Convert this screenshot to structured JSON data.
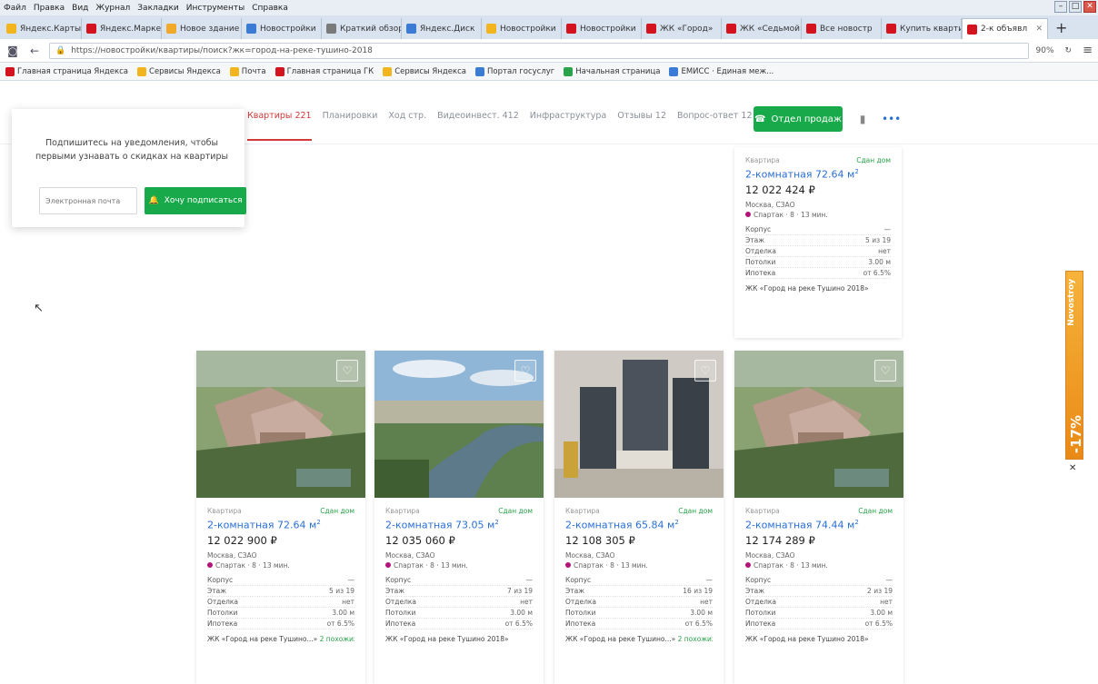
{
  "browser": {
    "menu": [
      "Файл",
      "Правка",
      "Вид",
      "Журнал",
      "Закладки",
      "Инструменты",
      "Справка"
    ],
    "tabs": [
      {
        "label": "Яндекс.Карты",
        "color": "#f2b51e"
      },
      {
        "label": "Яндекс.Маркет",
        "color": "#d3141e"
      },
      {
        "label": "Новое здание",
        "color": "#f1a92a"
      },
      {
        "label": "Новостройки",
        "color": "#3a7bd5"
      },
      {
        "label": "Краткий обзор",
        "color": "#7a7a7a"
      },
      {
        "label": "Яндекс.Диск",
        "color": "#3a7bd5"
      },
      {
        "label": "Новостройки",
        "color": "#f2b51e"
      },
      {
        "label": "Новостройки",
        "color": "#d3141e"
      },
      {
        "label": "ЖК «Город»",
        "color": "#d3141e"
      },
      {
        "label": "ЖК «Седьмой»",
        "color": "#d3141e"
      },
      {
        "label": "Все новостр",
        "color": "#d3141e"
      },
      {
        "label": "Купить квартиру",
        "color": "#d3141e"
      }
    ],
    "active_tab": "2-к объявл",
    "url": "https://новостройки/квартиры/поиск?жк=город-на-реке-тушино-2018",
    "zoom": "90%",
    "bookmarks": [
      {
        "label": "Главная страница Яндекса",
        "color": "#d3141e"
      },
      {
        "label": "Сервисы Яндекса",
        "color": "#f2b51e"
      },
      {
        "label": "Почта",
        "color": "#f2b51e"
      },
      {
        "label": "Главная страница ГК",
        "color": "#d3141e"
      },
      {
        "label": "Сервисы Яндекса",
        "color": "#f2b51e"
      },
      {
        "label": "Портал госуслуг",
        "color": "#3a7bd5"
      },
      {
        "label": "Начальная страница",
        "color": "#2aa34a"
      },
      {
        "label": "ЕМИСС · Единая меж...",
        "color": "#3a7bd5"
      }
    ]
  },
  "site_nav": {
    "tabs": [
      "Квартиры 221",
      "Планировки",
      "Ход стр.",
      "Видеоинвест. 412",
      "Инфраструктура",
      "Отзывы 12",
      "Вопрос-ответ 12"
    ],
    "call_label": "Отдел продаж"
  },
  "popup": {
    "text": "Подпишитесь на уведомления, чтобы первыми узнавать о скидках на квартиры",
    "input_placeholder": "Электронная почта",
    "button_label": "Хочу подписаться"
  },
  "cards": [
    {
      "badge": "Квартира",
      "status": "Сдан дом",
      "title": "2-комнатная 72.64 м",
      "price": "12 022 424 ₽",
      "address": "Москва, СЗАО",
      "metro": "Спартак · 8 · 13 мин.",
      "props": [
        [
          "Корпус",
          "—"
        ],
        [
          "Этаж",
          "5 из 19"
        ],
        [
          "Отделка",
          "нет"
        ],
        [
          "Потолки",
          "3.00 м"
        ],
        [
          "Ипотека",
          "от 6.5%"
        ]
      ],
      "complex": "ЖК «Город на реке Тушино 2018»",
      "more": ""
    },
    {
      "badge": "Квартира",
      "status": "Сдан дом",
      "title": "2-комнатная 72.64 м",
      "price": "12 022 900 ₽",
      "address": "Москва, СЗАО",
      "metro": "Спартак · 8 · 13 мин.",
      "props": [
        [
          "Корпус",
          "—"
        ],
        [
          "Этаж",
          "5 из 19"
        ],
        [
          "Отделка",
          "нет"
        ],
        [
          "Потолки",
          "3.00 м"
        ],
        [
          "Ипотека",
          "от 6.5%"
        ]
      ],
      "complex": "ЖК «Город на реке Тушино...»",
      "more": "2 похожих"
    },
    {
      "badge": "Квартира",
      "status": "Сдан дом",
      "title": "2-комнатная 73.05 м",
      "price": "12 035 060 ₽",
      "address": "Москва, СЗАО",
      "metro": "Спартак · 8 · 13 мин.",
      "props": [
        [
          "Корпус",
          "—"
        ],
        [
          "Этаж",
          "7 из 19"
        ],
        [
          "Отделка",
          "нет"
        ],
        [
          "Потолки",
          "3.00 м"
        ],
        [
          "Ипотека",
          "от 6.5%"
        ]
      ],
      "complex": "ЖК «Город на реке Тушино 2018»",
      "more": ""
    },
    {
      "badge": "Квартира",
      "status": "Сдан дом",
      "title": "2-комнатная 65.84 м",
      "price": "12 108 305 ₽",
      "address": "Москва, СЗАО",
      "metro": "Спартак · 8 · 13 мин.",
      "props": [
        [
          "Корпус",
          "—"
        ],
        [
          "Этаж",
          "16 из 19"
        ],
        [
          "Отделка",
          "нет"
        ],
        [
          "Потолки",
          "3.00 м"
        ],
        [
          "Ипотека",
          "от 6.5%"
        ]
      ],
      "complex": "ЖК «Город на реке Тушино...»",
      "more": "2 похожих"
    },
    {
      "badge": "Квартира",
      "status": "Сдан дом",
      "title": "2-комнатная 74.44 м",
      "price": "12 174 289 ₽",
      "address": "Москва, СЗАО",
      "metro": "Спартак · 8 · 13 мин.",
      "props": [
        [
          "Корпус",
          "—"
        ],
        [
          "Этаж",
          "2 из 19"
        ],
        [
          "Отделка",
          "нет"
        ],
        [
          "Потолки",
          "3.00 м"
        ],
        [
          "Ипотека",
          "от 6.5%"
        ]
      ],
      "complex": "ЖК «Город на реке Тушино 2018»",
      "more": ""
    }
  ],
  "side_ad": {
    "text": "Novostroy",
    "percent": "-17%"
  }
}
